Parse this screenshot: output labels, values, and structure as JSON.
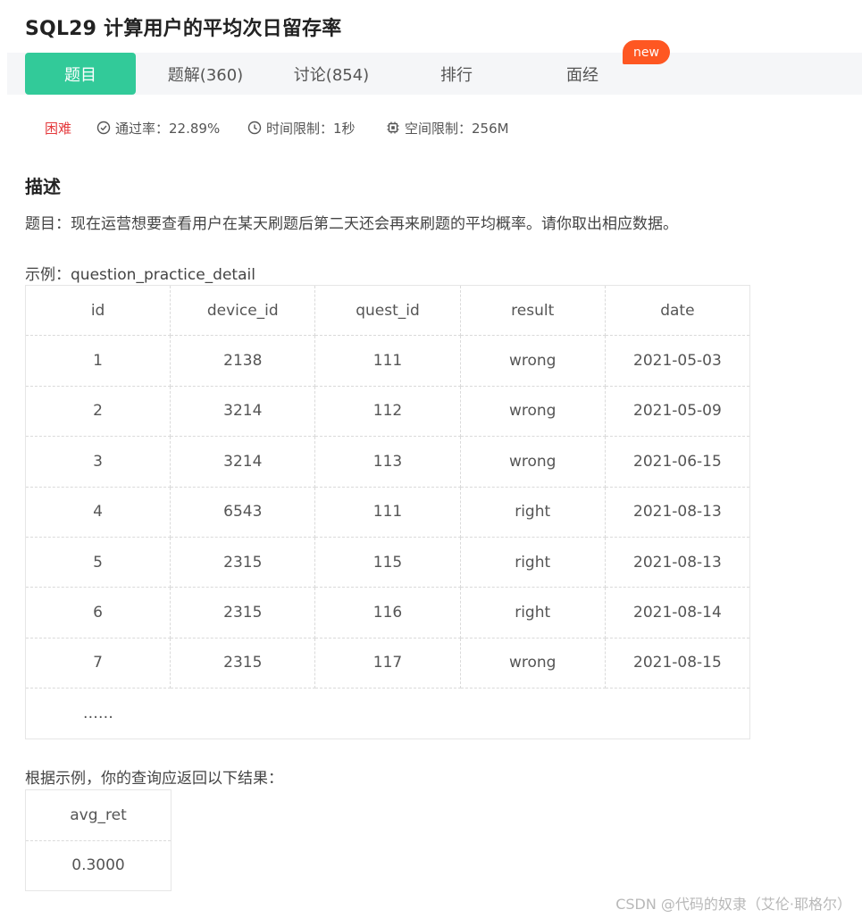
{
  "header": {
    "title": "SQL29  计算用户的平均次日留存率"
  },
  "tabs": [
    {
      "label": "题目",
      "active": true
    },
    {
      "label": "题解(360)"
    },
    {
      "label": "讨论(854)"
    },
    {
      "label": "排行"
    },
    {
      "label": "面经",
      "badge": "new"
    }
  ],
  "meta": {
    "difficulty": "困难",
    "pass_rate": "通过率：22.89%",
    "time_limit": "时间限制：1秒",
    "space_limit": "空间限制：256M",
    "difficulty_color": "#e4393c",
    "accent_color": "#32ca99",
    "badge_color": "#fe5722"
  },
  "description": {
    "heading": "描述",
    "text": "题目：现在运营想要查看用户在某天刷题后第二天还会再来刷题的平均概率。请你取出相应数据。",
    "example_label": "示例：question_practice_detail",
    "columns": [
      "id",
      "device_id",
      "quest_id",
      "result",
      "date"
    ],
    "rows": [
      [
        "1",
        "2138",
        "111",
        "wrong",
        "2021-05-03"
      ],
      [
        "2",
        "3214",
        "112",
        "wrong",
        "2021-05-09"
      ],
      [
        "3",
        "3214",
        "113",
        "wrong",
        "2021-06-15"
      ],
      [
        "4",
        "6543",
        "111",
        "right",
        "2021-08-13"
      ],
      [
        "5",
        "2315",
        "115",
        "right",
        "2021-08-13"
      ],
      [
        "6",
        "2315",
        "116",
        "right",
        "2021-08-14"
      ],
      [
        "7",
        "2315",
        "117",
        "wrong",
        "2021-08-15"
      ]
    ],
    "ellipsis": "……",
    "result_label": "根据示例，你的查询应返回以下结果：",
    "result_columns": [
      "avg_ret"
    ],
    "result_rows": [
      [
        "0.3000"
      ]
    ]
  },
  "watermark": "CSDN @代码的奴隶（艾伦·耶格尔）",
  "icons": {
    "pass_rate": "check-circle-icon",
    "time_limit": "clock-icon",
    "space_limit": "chip-icon"
  }
}
